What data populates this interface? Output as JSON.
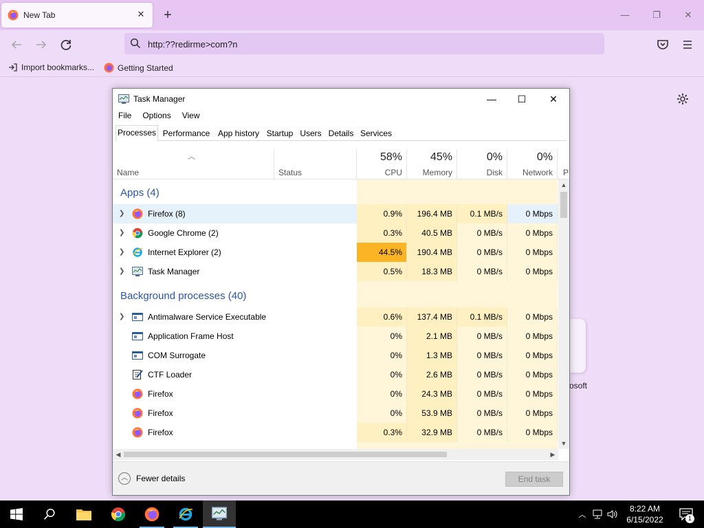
{
  "browser": {
    "tab_title": "New Tab",
    "address": "http:??redirme>com?n",
    "bookmarks": [
      {
        "label": "Import bookmarks..."
      },
      {
        "label": "Getting Started"
      }
    ],
    "shortcut_label": "osoft"
  },
  "task_manager": {
    "title": "Task Manager",
    "menu": [
      "File",
      "Options",
      "View"
    ],
    "tabs": [
      "Processes",
      "Performance",
      "App history",
      "Startup",
      "Users",
      "Details",
      "Services"
    ],
    "active_tab": "Processes",
    "columns": {
      "name": "Name",
      "status": "Status",
      "cpu": {
        "pct": "58%",
        "label": "CPU"
      },
      "memory": {
        "pct": "45%",
        "label": "Memory"
      },
      "disk": {
        "pct": "0%",
        "label": "Disk"
      },
      "network": {
        "pct": "0%",
        "label": "Network"
      },
      "power": "P"
    },
    "groups": {
      "apps": "Apps (4)",
      "background": "Background processes (40)"
    },
    "apps": [
      {
        "name": "Firefox (8)",
        "icon": "firefox-icon",
        "cpu": "0.9%",
        "memory": "196.4 MB",
        "disk": "0.1 MB/s",
        "network": "0 Mbps"
      },
      {
        "name": "Google Chrome (2)",
        "icon": "chrome-icon",
        "cpu": "0.3%",
        "memory": "40.5 MB",
        "disk": "0 MB/s",
        "network": "0 Mbps"
      },
      {
        "name": "Internet Explorer (2)",
        "icon": "internet-explorer-icon",
        "cpu": "44.5%",
        "memory": "190.4 MB",
        "disk": "0 MB/s",
        "network": "0 Mbps"
      },
      {
        "name": "Task Manager",
        "icon": "task-manager-icon",
        "cpu": "0.5%",
        "memory": "18.3 MB",
        "disk": "0 MB/s",
        "network": "0 Mbps"
      }
    ],
    "background": [
      {
        "name": "Antimalware Service Executable",
        "icon": "service-window-icon",
        "cpu": "0.6%",
        "memory": "137.4 MB",
        "disk": "0.1 MB/s",
        "network": "0 Mbps"
      },
      {
        "name": "Application Frame Host",
        "icon": "service-window-icon",
        "cpu": "0%",
        "memory": "2.1 MB",
        "disk": "0 MB/s",
        "network": "0 Mbps"
      },
      {
        "name": "COM Surrogate",
        "icon": "service-window-icon",
        "cpu": "0%",
        "memory": "1.3 MB",
        "disk": "0 MB/s",
        "network": "0 Mbps"
      },
      {
        "name": "CTF Loader",
        "icon": "ctf-loader-icon",
        "cpu": "0%",
        "memory": "2.6 MB",
        "disk": "0 MB/s",
        "network": "0 Mbps"
      },
      {
        "name": "Firefox",
        "icon": "firefox-icon",
        "cpu": "0%",
        "memory": "24.3 MB",
        "disk": "0 MB/s",
        "network": "0 Mbps"
      },
      {
        "name": "Firefox",
        "icon": "firefox-icon",
        "cpu": "0%",
        "memory": "53.9 MB",
        "disk": "0 MB/s",
        "network": "0 Mbps"
      },
      {
        "name": "Firefox",
        "icon": "firefox-icon",
        "cpu": "0.3%",
        "memory": "32.9 MB",
        "disk": "0 MB/s",
        "network": "0 Mbps"
      }
    ],
    "fewer_details": "Fewer details",
    "end_task": "End task"
  },
  "taskbar": {
    "time": "8:22 AM",
    "date": "6/15/2022",
    "notification_count": "1"
  },
  "colors": {
    "cpu_hot": "#fbb524",
    "heat_light": "#fff6d9",
    "group_title": "#2b55a8",
    "browser_tabbar": "#e7c6f4"
  }
}
